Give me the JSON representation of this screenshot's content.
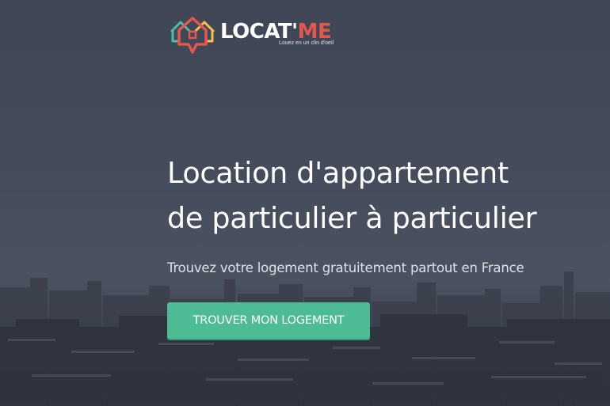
{
  "brand": {
    "name_part1": "LOCAT'",
    "name_part2": "ME",
    "tagline": "Louez en un clin d'oeil",
    "logo_icon": "house-map-pin-icon",
    "colors": {
      "accent_red": "#e2584d",
      "accent_teal": "#4dbba6",
      "accent_yellow": "#f2c14e"
    }
  },
  "hero": {
    "headline_line1": "Location d'appartement",
    "headline_line2": "de particulier à particulier",
    "subtitle": "Trouvez votre logement gratuitement partout en France",
    "cta_label": "TROUVER MON LOGEMENT",
    "cta_color": "#4dbb94",
    "background": "city-skyline-photo"
  }
}
